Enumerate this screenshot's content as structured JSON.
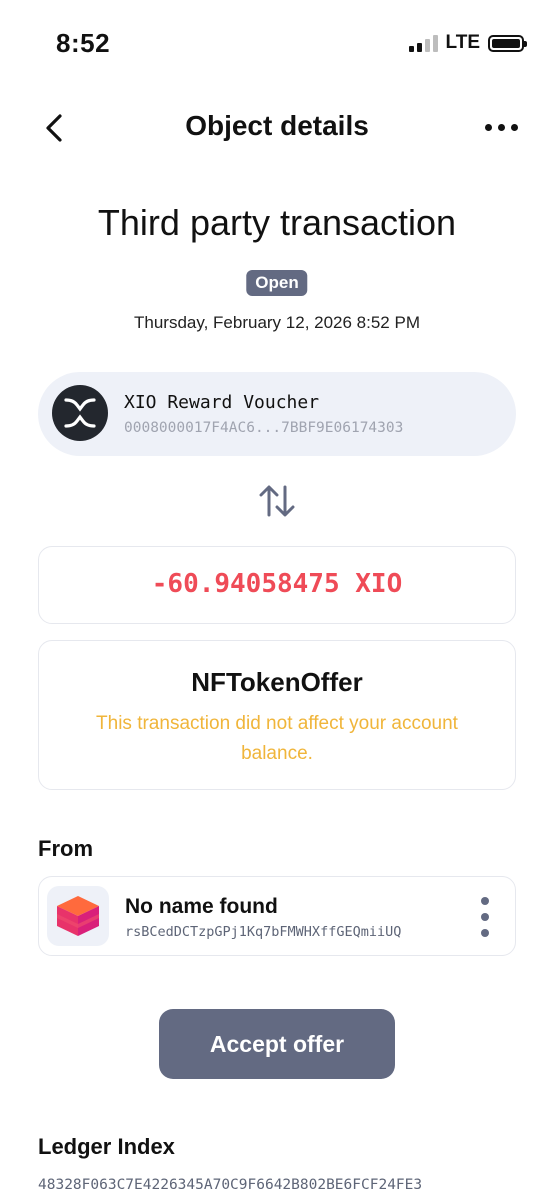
{
  "status_bar": {
    "time": "8:52",
    "network": "LTE"
  },
  "header": {
    "title": "Object details",
    "back_icon": "chevron-left-icon",
    "more_icon": "more-horizontal-icon"
  },
  "transaction": {
    "title": "Third party transaction",
    "status": "Open",
    "date": "Thursday, February 12, 2026 8:52 PM"
  },
  "token": {
    "name": "XIO Reward Voucher",
    "id": "0008000017F4AC6...7BBF9E06174303",
    "icon": "xrp-logo-icon"
  },
  "swap_icon": "swap-arrows-icon",
  "amount": {
    "text": "-60.94058475 XIO",
    "color": "#ef4b57"
  },
  "type_card": {
    "name": "NFTokenOffer",
    "note": "This transaction did not affect your account balance.",
    "note_color": "#f0b53a"
  },
  "from": {
    "label": "From",
    "name": "No name found",
    "address": "rsBCedDCTzpGPj1Kq7bFMWHXffGEQmiiUQ",
    "avatar_icon": "cube-avatar-icon",
    "menu_icon": "more-vertical-icon"
  },
  "actions": {
    "accept_label": "Accept offer"
  },
  "ledger": {
    "label": "Ledger Index",
    "value": "48328F063C7E4226345A70C9F6642B802BE6FCF24FE3"
  },
  "colors": {
    "accent": "#636a82",
    "card_bg": "#eef1f8"
  }
}
